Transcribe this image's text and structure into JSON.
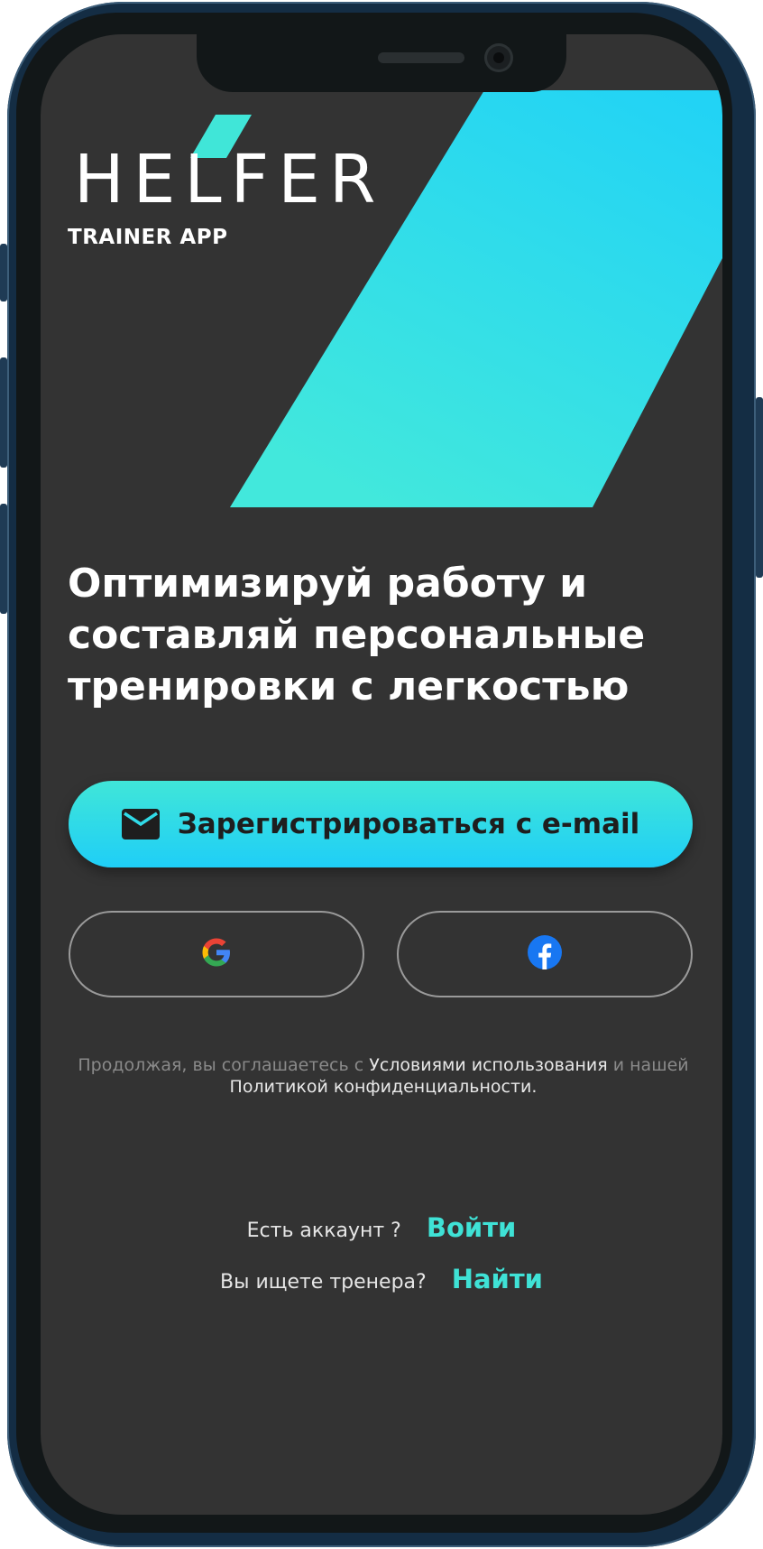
{
  "brand": {
    "logo_text": "HELFER",
    "subtitle": "TRAINER APP"
  },
  "headline": {
    "line1": "Оптимизируй работу и",
    "line2": "составляй персональные",
    "line3": "тренировки с легкостью"
  },
  "signup": {
    "email_button_label": "Зарегистрироваться с e-mail",
    "email_icon": "mail-icon"
  },
  "social": {
    "google_icon": "google-icon",
    "facebook_icon": "facebook-icon"
  },
  "legal": {
    "prefix": "Продолжая, вы соглашаетесь с",
    "terms_link": "Условиями использования",
    "middle": "и нашей",
    "privacy_link": "Политикой конфиденциальности."
  },
  "account": {
    "question": "Есть аккаунт ?",
    "login_link": "Войти"
  },
  "trainer": {
    "question": "Вы ищете тренера?",
    "find_link": "Найти"
  },
  "colors": {
    "accent_teal": "#40e6d8",
    "accent_blue": "#1fcef7",
    "screen_bg": "#333333",
    "link_color": "#3fe2d6"
  }
}
